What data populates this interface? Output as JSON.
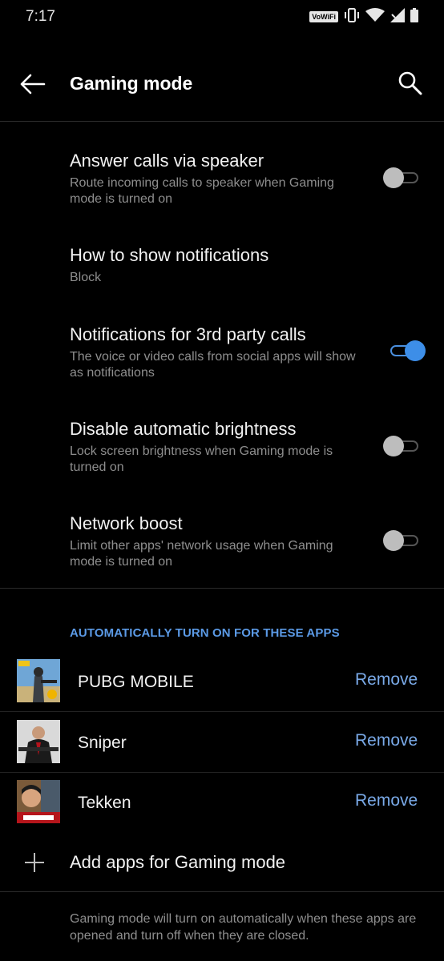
{
  "status_bar": {
    "time": "7:17",
    "vowifi": "VoWiFi",
    "icons": [
      "vibrate-icon",
      "wifi-icon",
      "signal-icon",
      "battery-icon"
    ]
  },
  "header": {
    "title": "Gaming mode",
    "back_icon": "back-arrow-icon",
    "search_icon": "search-icon"
  },
  "settings": [
    {
      "title": "Answer calls via speaker",
      "subtitle": "Route incoming calls to speaker when Gaming mode is turned on",
      "toggle": false
    },
    {
      "title": "How to show notifications",
      "subtitle": "Block"
    },
    {
      "title": "Notifications for 3rd party calls",
      "subtitle": "The voice or video calls from social apps will show as notifications",
      "toggle": true
    },
    {
      "title": "Disable automatic brightness",
      "subtitle": "Lock screen brightness when Gaming mode is turned on",
      "toggle": false
    },
    {
      "title": "Network boost",
      "subtitle": "Limit other apps' network usage when Gaming mode is turned on",
      "toggle": false
    }
  ],
  "apps_section": {
    "header": "AUTOMATICALLY TURN ON FOR THESE APPS",
    "apps": [
      {
        "name": "PUBG MOBILE",
        "action": "Remove",
        "icon": "pubg-app-icon"
      },
      {
        "name": "Sniper",
        "action": "Remove",
        "icon": "sniper-app-icon"
      },
      {
        "name": "Tekken",
        "action": "Remove",
        "icon": "tekken-app-icon"
      }
    ],
    "add_label": "Add apps for Gaming mode",
    "footer": "Gaming mode will turn on automatically when these apps are opened and turn off when they are closed."
  },
  "colors": {
    "background": "#000000",
    "accent": "#3d8ee8",
    "section_header": "#5b9ae6",
    "link": "#7aaae8",
    "secondary_text": "#8e8e8e"
  }
}
